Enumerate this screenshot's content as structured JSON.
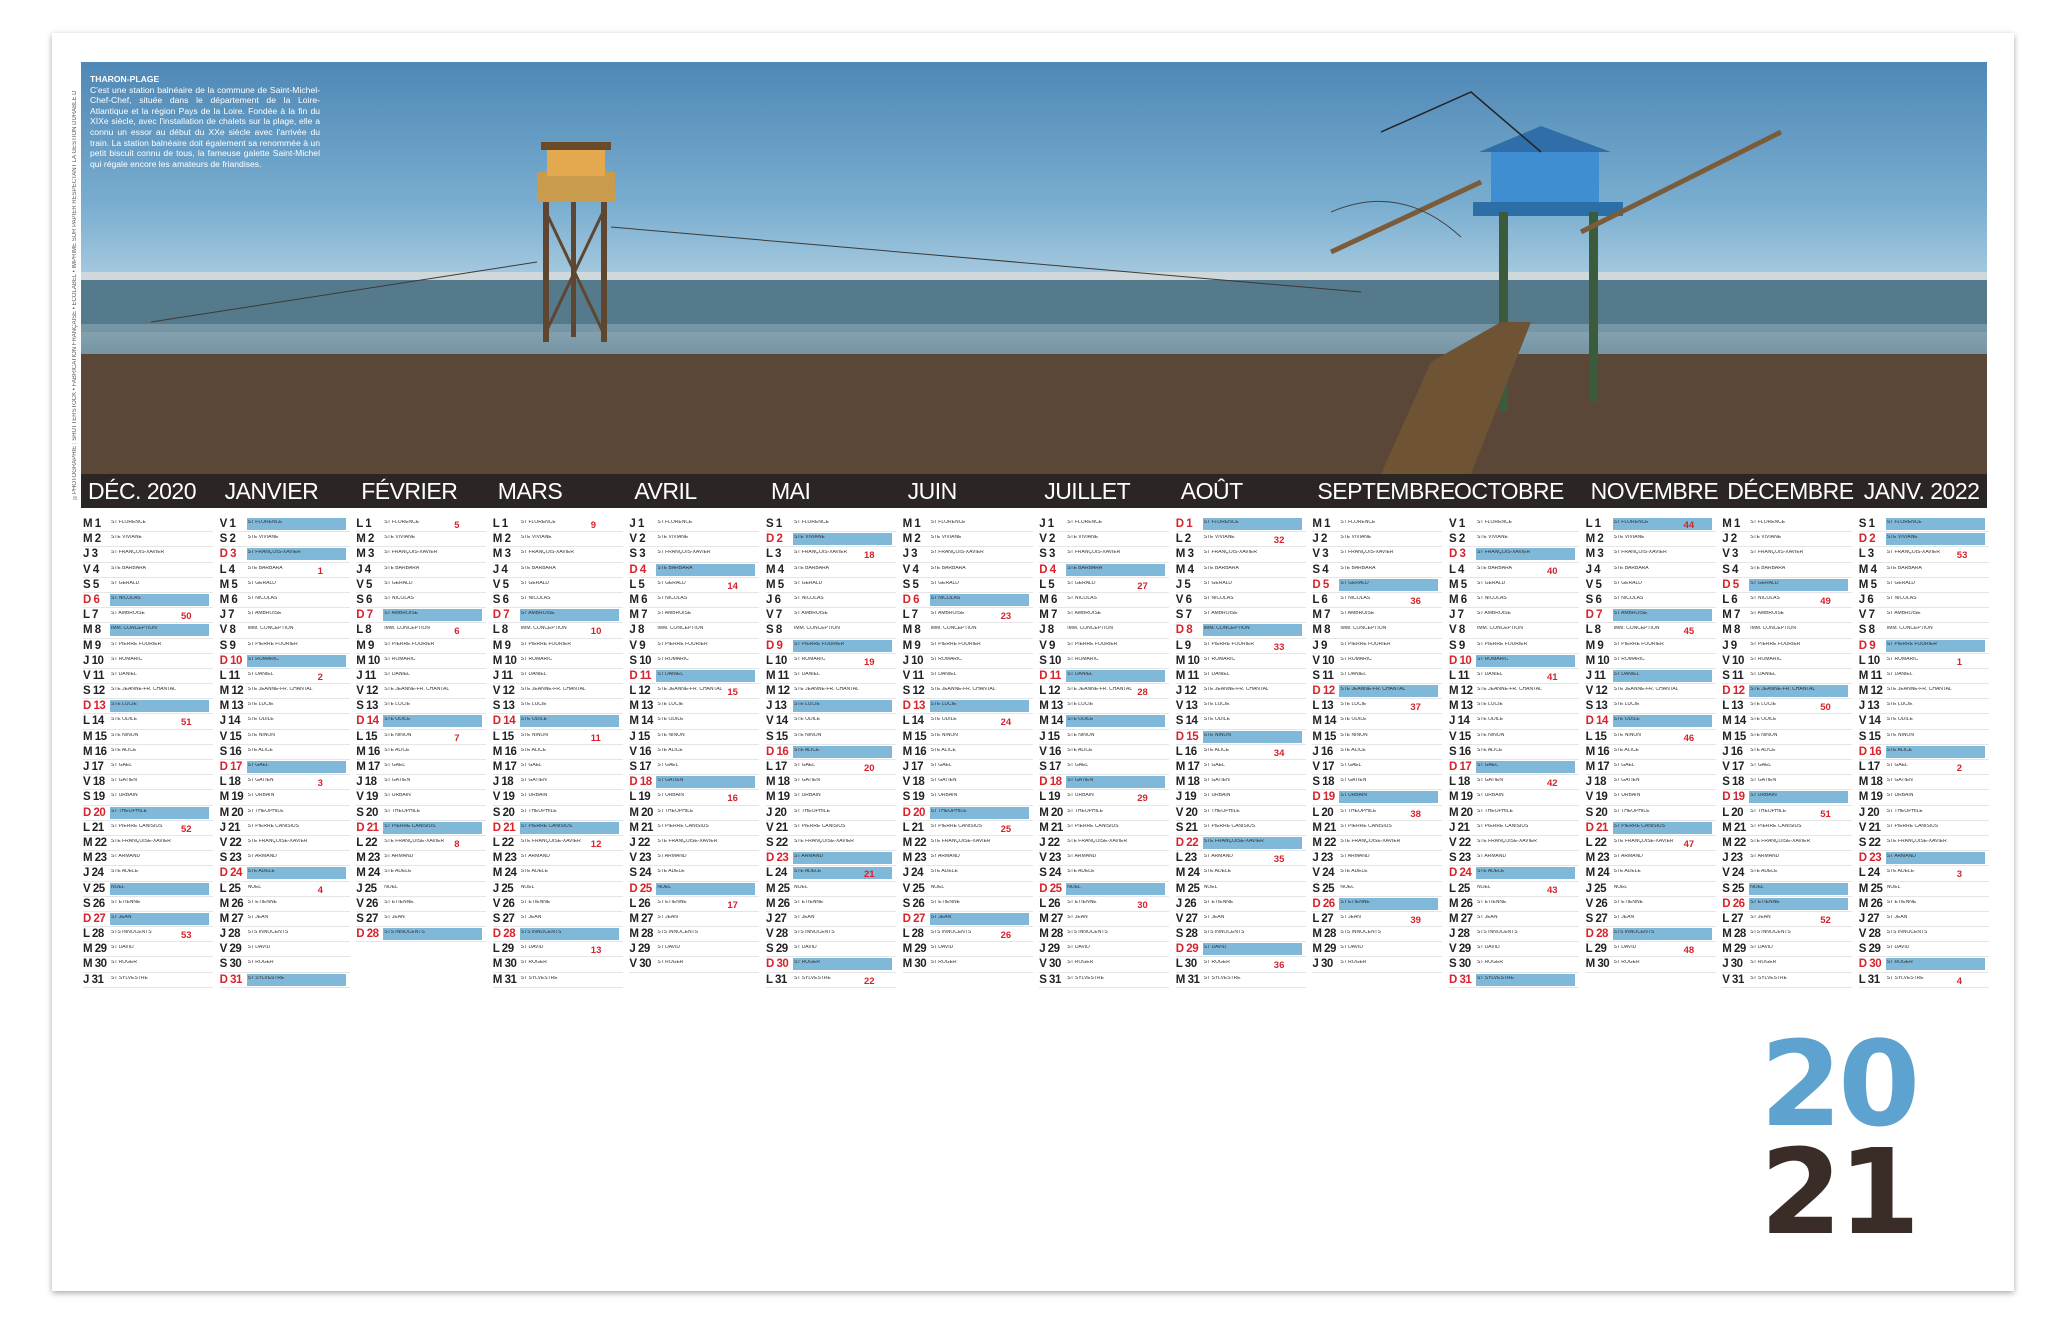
{
  "caption": {
    "title": "THARON-PLAGE",
    "text": "C'est une station balnéaire de la commune de Saint-Michel-Chef-Chef, située dans le département de la Loire-Atlantique et la région Pays de la Loire. Fondée à la fin du XIXe siècle, avec l'installation de chalets sur la plage, elle a connu un essor au début du XXe siècle avec l'arrivée du train. La station balnéaire doit également sa renommée à un petit biscuit connu de tous, la fameuse galette Saint-Michel qui régale encore les amateurs de friandises."
  },
  "vertical_credit": "©PHOTOGRAPHIE : SHUTTERSTOCK • FABRICATION FRANÇAISE • ÉCOLABEL • IMPRIMÉ SUR PAPIER RESPECTANT LA GESTION DURABLE DE LA FORÊT",
  "months": [
    "DÉC. 2020",
    "JANVIER",
    "FÉVRIER",
    "MARS",
    "AVRIL",
    "MAI",
    "JUIN",
    "JUILLET",
    "AOÛT",
    "SEPTEMBRE",
    "OCTOBRE",
    "NOVEMBRE",
    "DÉCEMBRE",
    "JANV. 2022"
  ],
  "year": {
    "top": "20",
    "bottom": "21"
  },
  "colors": {
    "sunday": "#d6232c",
    "highlight": "#7fb8d9",
    "bar": "#2b2523"
  },
  "calendar": {
    "day_letters": [
      "L",
      "M",
      "M",
      "J",
      "V",
      "S",
      "D"
    ],
    "start_weekday": [
      1,
      4,
      0,
      0,
      3,
      5,
      1,
      3,
      6,
      2,
      4,
      0,
      2,
      5
    ],
    "lengths": [
      31,
      31,
      28,
      31,
      30,
      31,
      30,
      31,
      31,
      30,
      31,
      30,
      31,
      31
    ],
    "first_week": [
      49,
      53,
      5,
      9,
      13,
      17,
      22,
      26,
      31,
      35,
      39,
      44,
      48,
      52
    ],
    "highlighted": {
      "0": [
        6,
        8,
        13,
        20,
        25,
        27
      ],
      "1": [
        1,
        3,
        10,
        17,
        24,
        31
      ],
      "2": [
        7,
        14,
        21,
        28
      ],
      "3": [
        7,
        14,
        21,
        28
      ],
      "4": [
        4,
        11,
        18,
        25
      ],
      "5": [
        2,
        9,
        13,
        16,
        23,
        24,
        30
      ],
      "6": [
        6,
        13,
        20,
        27
      ],
      "7": [
        4,
        11,
        14,
        18,
        25
      ],
      "8": [
        1,
        8,
        15,
        22,
        29
      ],
      "9": [
        5,
        12,
        19,
        26
      ],
      "10": [
        3,
        10,
        17,
        24,
        31
      ],
      "11": [
        1,
        7,
        11,
        14,
        21,
        28
      ],
      "12": [
        5,
        12,
        19,
        25,
        26
      ],
      "13": [
        1,
        2,
        9,
        16,
        23,
        30
      ]
    },
    "saints": [
      "ST FLORENCE",
      "STE VIVIANE",
      "ST FRANÇOIS-XAVIER",
      "STE BARBARA",
      "ST GÉRALD",
      "ST NICOLAS",
      "ST AMBROISE",
      "IMM. CONCEPTION",
      "ST PIERRE FOURIER",
      "ST ROMARIC",
      "ST DANIEL",
      "STE JEANNE-FR. CHANTAL",
      "STE LUCIE",
      "STE ODILE",
      "STE NINON",
      "STE ALICE",
      "ST GAËL",
      "ST GATIEN",
      "ST URBAIN",
      "ST THÉOPHILE",
      "ST PIERRE CANISIUS",
      "STE FRANÇOISE-XAVIER",
      "ST ARMAND",
      "STE ADÈLE",
      "NOËL",
      "ST ÉTIENNE",
      "ST JEAN",
      "STS INNOCENTS",
      "ST DAVID",
      "ST ROGER",
      "ST SYLVESTRE"
    ]
  }
}
